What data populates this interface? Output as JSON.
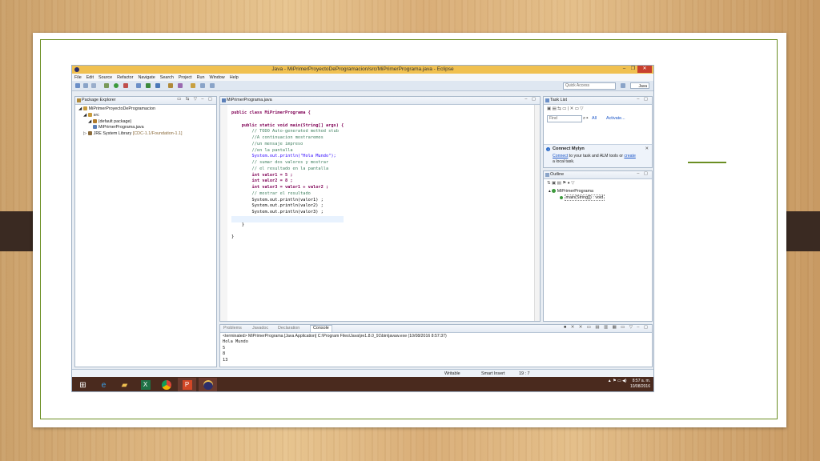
{
  "window": {
    "title": "Java - MiPrimerProyectoDeProgramacion/src/MiPrimerPrograma.java - Eclipse",
    "controls": [
      "–",
      "❐",
      "✕"
    ]
  },
  "menu": [
    "File",
    "Edit",
    "Source",
    "Refactor",
    "Navigate",
    "Search",
    "Project",
    "Run",
    "Window",
    "Help"
  ],
  "toolbar": {
    "quick_access_placeholder": "Quick Access",
    "perspective": "Java"
  },
  "package_explorer": {
    "tab": "Package Explorer",
    "tree": [
      {
        "label": "MiPrimerProyectoDeProgramacion",
        "indent": 0,
        "icon_color": "#c89b3c"
      },
      {
        "label": "src",
        "indent": 1,
        "icon_color": "#c89b3c"
      },
      {
        "label": "(default package)",
        "indent": 2,
        "icon_color": "#b07a2a"
      },
      {
        "label": "MiPrimerPrograma.java",
        "indent": 3,
        "icon_color": "#5b7fb8"
      },
      {
        "label": "JRE System Library",
        "suffix": "[CDC-1.1/Foundation-1.1]",
        "indent": 1,
        "icon_color": "#8a6a3a"
      }
    ]
  },
  "editor": {
    "tab": "MiPrimerPrograma.java",
    "lines": [
      {
        "t": "public class MiPrimerPrograma {",
        "k": "kw"
      },
      {
        "t": "",
        "k": ""
      },
      {
        "t": "    public static void main(String[] args) {",
        "k": "kw"
      },
      {
        "t": "        // TODO Auto-generated method stub",
        "k": "cm"
      },
      {
        "t": "        //A continuacion mostraremos",
        "k": "cm"
      },
      {
        "t": "        //un mensaje impreso",
        "k": "cm"
      },
      {
        "t": "        //en la pantalla",
        "k": "cm"
      },
      {
        "t": "        System.out.println(\"Hola Mundo\");",
        "k": "st"
      },
      {
        "t": "        // sumar dos valores y mostrar",
        "k": "cm"
      },
      {
        "t": "        // el resultado en la pantalla",
        "k": "cm"
      },
      {
        "t": "        int valor1 = 5 ;",
        "k": "kw"
      },
      {
        "t": "        int valor2 = 8 ;",
        "k": "kw"
      },
      {
        "t": "        int valor3 = valor1 + valor2 ;",
        "k": "kw"
      },
      {
        "t": "        // mostrar el resultado",
        "k": "cm"
      },
      {
        "t": "        System.out.println(valor1) ;",
        "k": ""
      },
      {
        "t": "        System.out.println(valor2) ;",
        "k": ""
      },
      {
        "t": "        System.out.println(valor3) ;",
        "k": ""
      },
      {
        "t": "",
        "k": ""
      },
      {
        "t": "    }",
        "k": ""
      },
      {
        "t": "",
        "k": ""
      },
      {
        "t": "}",
        "k": ""
      }
    ]
  },
  "task_list": {
    "tab": "Task List",
    "find_placeholder": "Find",
    "all": "All",
    "activate": "Activate..."
  },
  "mylyn": {
    "title": "Connect Mylyn",
    "connect": "Connect",
    "text1": " to your task and ALM tools or ",
    "create": "create",
    "text2": "a local task."
  },
  "outline": {
    "tab": "Outline",
    "class_name": "MiPrimerPrograma",
    "method": "main(String[]) : void"
  },
  "bottom_tabs": [
    "Problems",
    "Javadoc",
    "Declaration",
    "Console"
  ],
  "console": {
    "header": "<terminated> MiPrimerPrograma [Java Application] C:\\Program Files\\Java\\jre1.8.0_91\\bin\\javaw.exe (10/08/2016 8:57:37)",
    "output": [
      "Hola Mundo",
      "5",
      "8",
      "13"
    ]
  },
  "status": {
    "writable": "Writable",
    "insert": "Smart Insert",
    "position": "19 : 7"
  },
  "taskbar": {
    "time": "8:57 a. m.",
    "date": "10/08/2016",
    "tray": "▲ ⚑ ▭ ◀)"
  }
}
